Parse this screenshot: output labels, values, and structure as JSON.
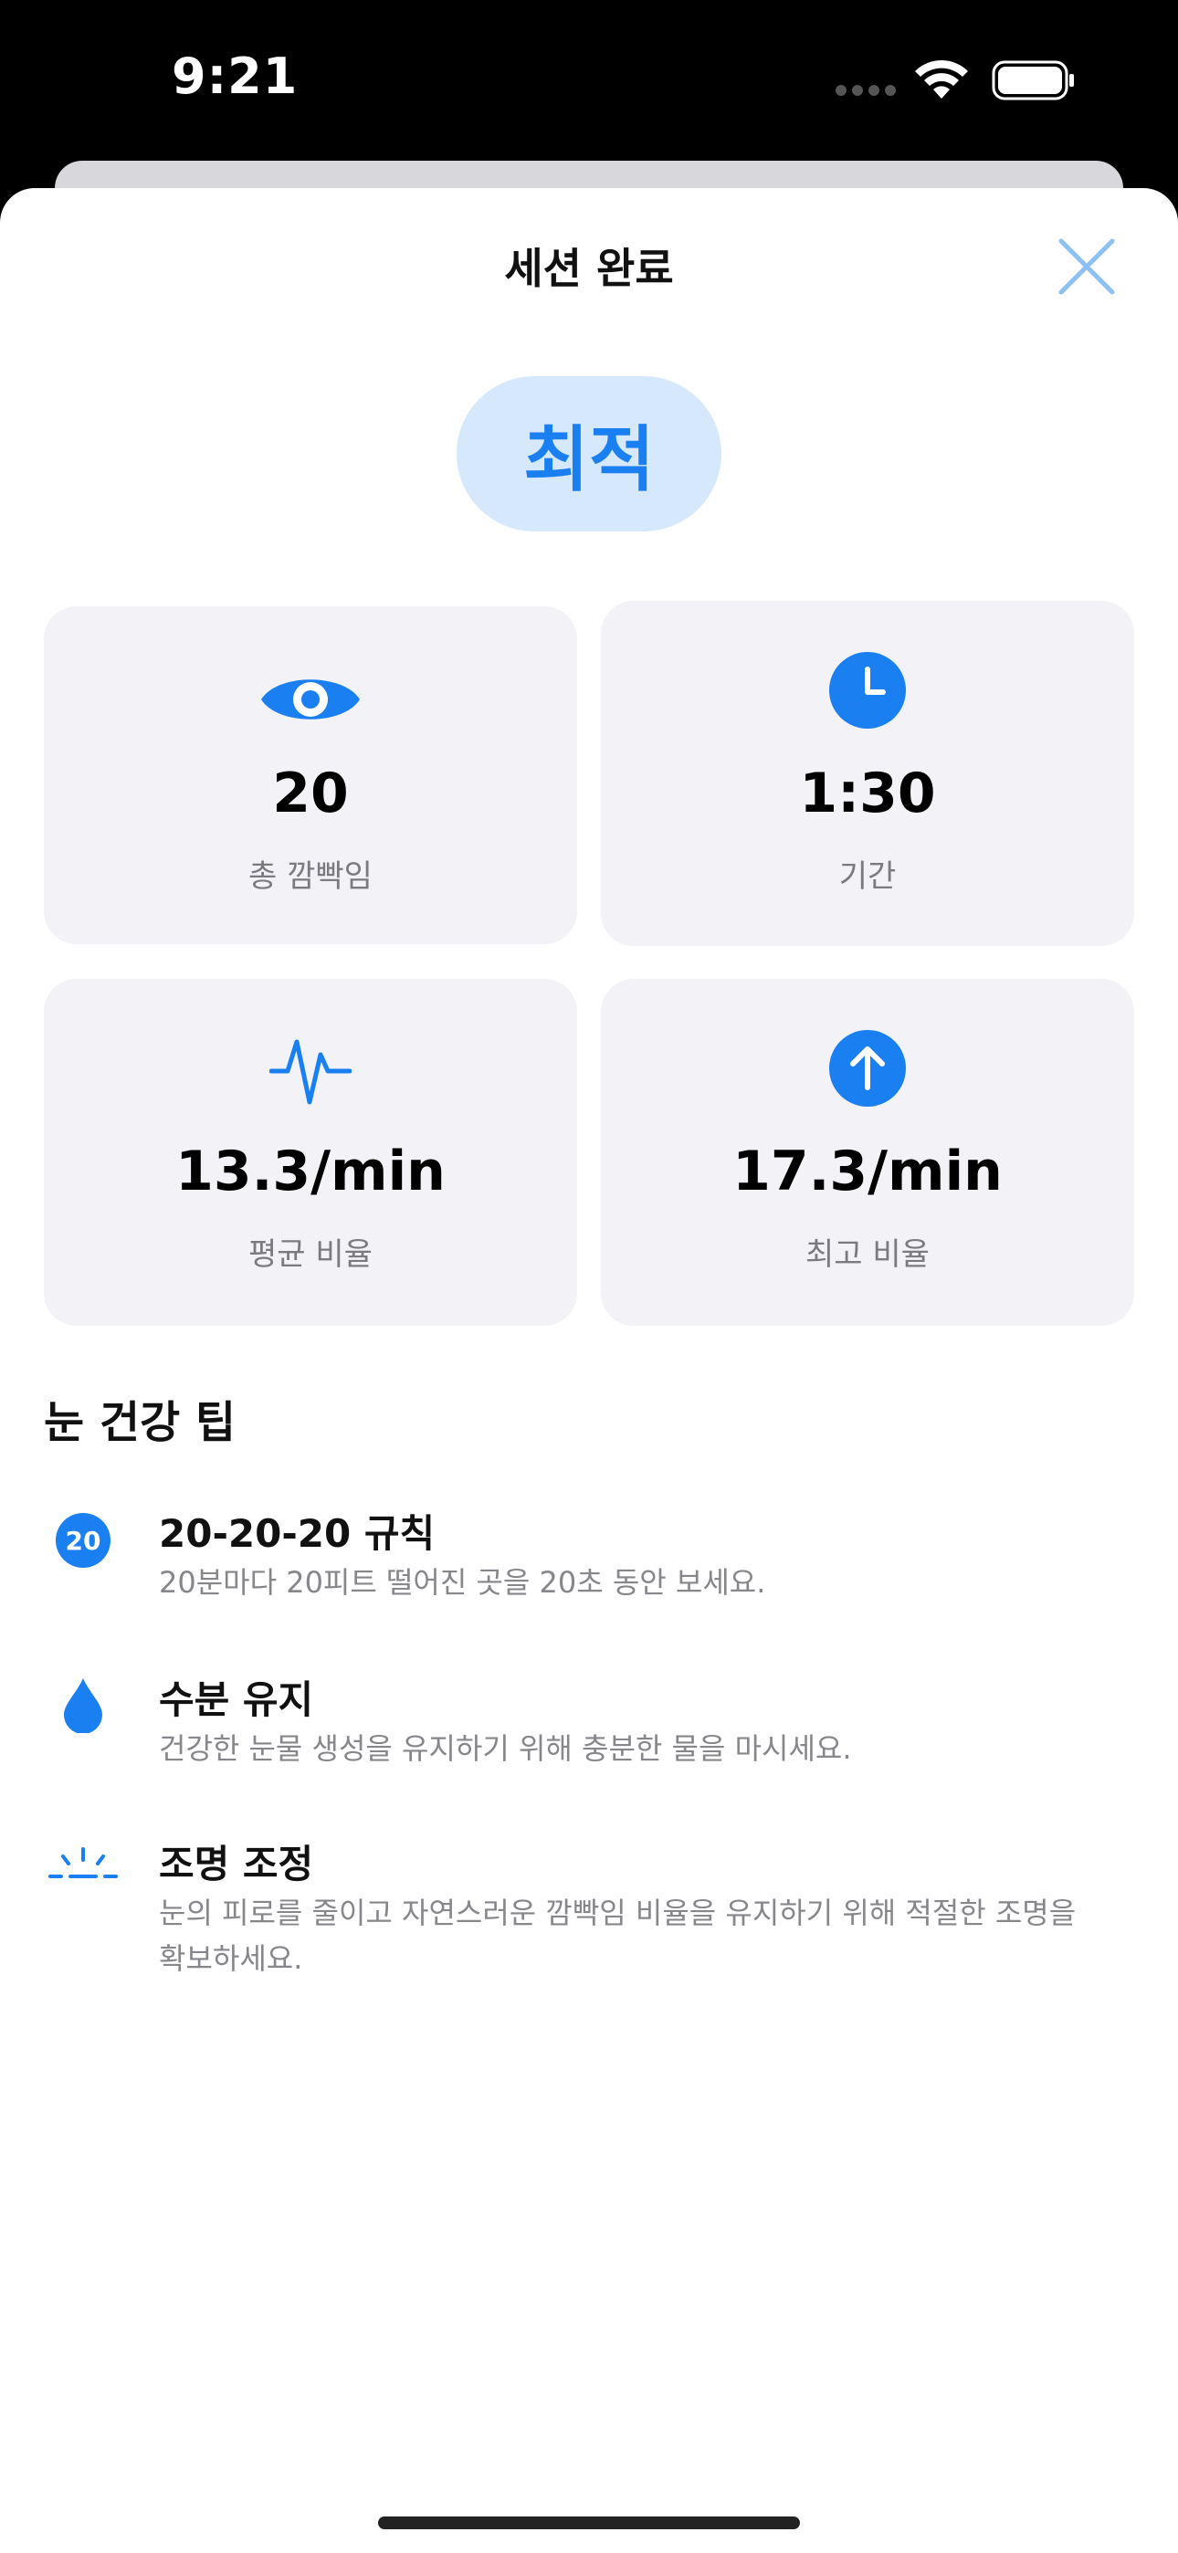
{
  "status_bar": {
    "time": "9:21",
    "icons": [
      "signal-dots-icon",
      "wifi-icon",
      "battery-icon"
    ]
  },
  "sheet": {
    "title": "세션 완료",
    "close_icon": "close-icon",
    "badge": "최적"
  },
  "stats": [
    {
      "icon": "eye-icon",
      "value": "20",
      "label": "총 깜빡임"
    },
    {
      "icon": "clock-icon",
      "value": "1:30",
      "label": "기간"
    },
    {
      "icon": "waveform-icon",
      "value": "13.3/min",
      "label": "평균 비율"
    },
    {
      "icon": "arrow-up-circle-icon",
      "value": "17.3/min",
      "label": "최고 비율"
    }
  ],
  "tips_section": {
    "title": "눈 건강 팁",
    "items": [
      {
        "icon": "twenty-circle-icon",
        "icon_text": "20",
        "title": "20-20-20 규칙",
        "desc": "20분마다 20피트 떨어진 곳을 20초 동안 보세요."
      },
      {
        "icon": "drop-icon",
        "title": "수분 유지",
        "desc": "건강한 눈물 생성을 유지하기 위해 충분한 물을 마시세요."
      },
      {
        "icon": "light-icon",
        "title": "조명 조정",
        "desc": "눈의 피로를 줄이고 자연스러운 깜빡임 비율을 유지하기 위해 적절한 조명을 확보하세요."
      }
    ]
  },
  "colors": {
    "accent": "#1a7ff0",
    "badge_bg": "#d6e8fb",
    "card_bg": "#f2f2f7",
    "secondary_text": "#86868b"
  }
}
